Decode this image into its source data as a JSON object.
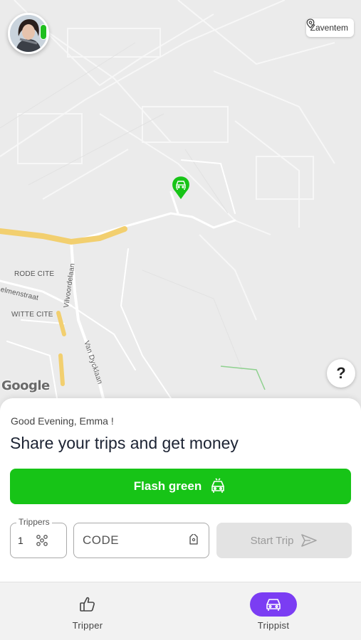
{
  "map": {
    "location_label": "Zaventem",
    "street_labels": {
      "rode_cite": "RODE CITE",
      "elmenstraat": "elmenstraat",
      "witte_cite": "WITTE CITE",
      "vilvoordelaan": "Vilvoordelaan",
      "van_dycklaan": "Van Dycklaan"
    },
    "attribution": "Google",
    "help_label": "?"
  },
  "sheet": {
    "greeting": "Good Evening, Emma !",
    "headline": "Share your trips and get money",
    "flash_button_label": "Flash green",
    "trippers_label": "Trippers",
    "trippers_value": "1",
    "code_placeholder": "CODE",
    "start_button_label": "Start Trip"
  },
  "nav": {
    "items": [
      {
        "label": "Tripper",
        "icon": "thumbs-up-icon",
        "active": false
      },
      {
        "label": "Trippist",
        "icon": "car-icon",
        "active": true
      }
    ]
  },
  "colors": {
    "primary_green": "#17c417",
    "active_purple": "#7b3df3",
    "disabled_gray": "#e3e3e3"
  }
}
